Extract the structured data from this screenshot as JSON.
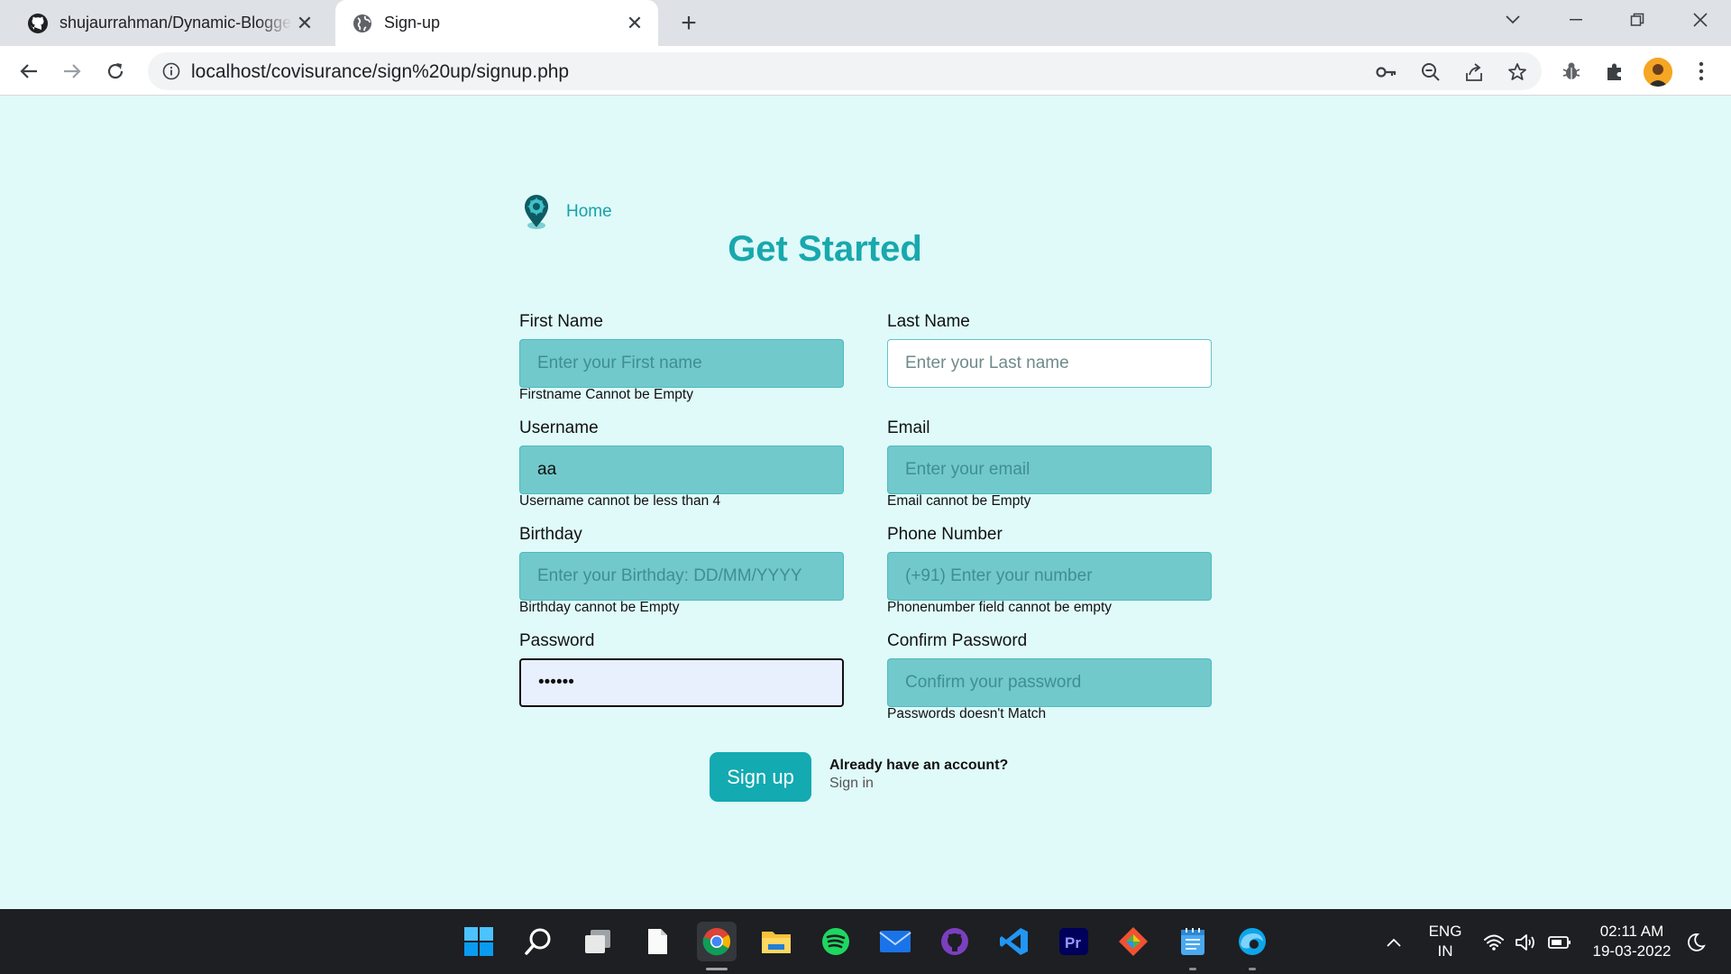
{
  "browser": {
    "tabs": [
      {
        "title": "shujaurrahman/Dynamic-Blogger",
        "icon": "github-icon"
      },
      {
        "title": "Sign-up",
        "icon": "globe-icon"
      }
    ],
    "url": "localhost/covisurance/sign%20up/signup.php"
  },
  "page": {
    "home_label": "Home",
    "title": "Get Started",
    "fields": {
      "first_name": {
        "label": "First Name",
        "placeholder": "Enter your First name",
        "value": "",
        "error": "Firstname Cannot be Empty"
      },
      "last_name": {
        "label": "Last Name",
        "placeholder": "Enter your Last name",
        "value": "",
        "error": ""
      },
      "username": {
        "label": "Username",
        "placeholder": "",
        "value": "aa",
        "error": "Username cannot be less than 4"
      },
      "email": {
        "label": "Email",
        "placeholder": "Enter your email",
        "value": "",
        "error": "Email cannot be Empty"
      },
      "birthday": {
        "label": "Birthday",
        "placeholder": "Enter your Birthday: DD/MM/YYYY",
        "value": "",
        "error": "Birthday cannot be Empty"
      },
      "phone": {
        "label": "Phone Number",
        "placeholder": "(+91) Enter your number",
        "value": "",
        "error": "Phonenumber field cannot be empty"
      },
      "password": {
        "label": "Password",
        "placeholder": "",
        "value": "••••••",
        "error": ""
      },
      "confirm_password": {
        "label": "Confirm Password",
        "placeholder": "Confirm your password",
        "value": "",
        "error": "Passwords doesn't Match"
      }
    },
    "signup_label": "Sign up",
    "have_account": "Already have an account?",
    "signin_label": "Sign in"
  },
  "taskbar": {
    "apps": [
      "windows-start-icon",
      "search-icon",
      "task-view-icon",
      "file-icon",
      "chrome-icon",
      "file-explorer-icon",
      "spotify-icon",
      "mail-icon",
      "github-desktop-icon",
      "vscode-icon",
      "premiere-pro-icon",
      "git-icon",
      "notepad-icon",
      "edge-icon"
    ],
    "language": "ENG",
    "region": "IN",
    "time": "02:11 AM",
    "date": "19-03-2022"
  },
  "colors": {
    "page_background": "#e0fafa",
    "accent": "#13aab1",
    "input_fill": "#72c9cb"
  }
}
